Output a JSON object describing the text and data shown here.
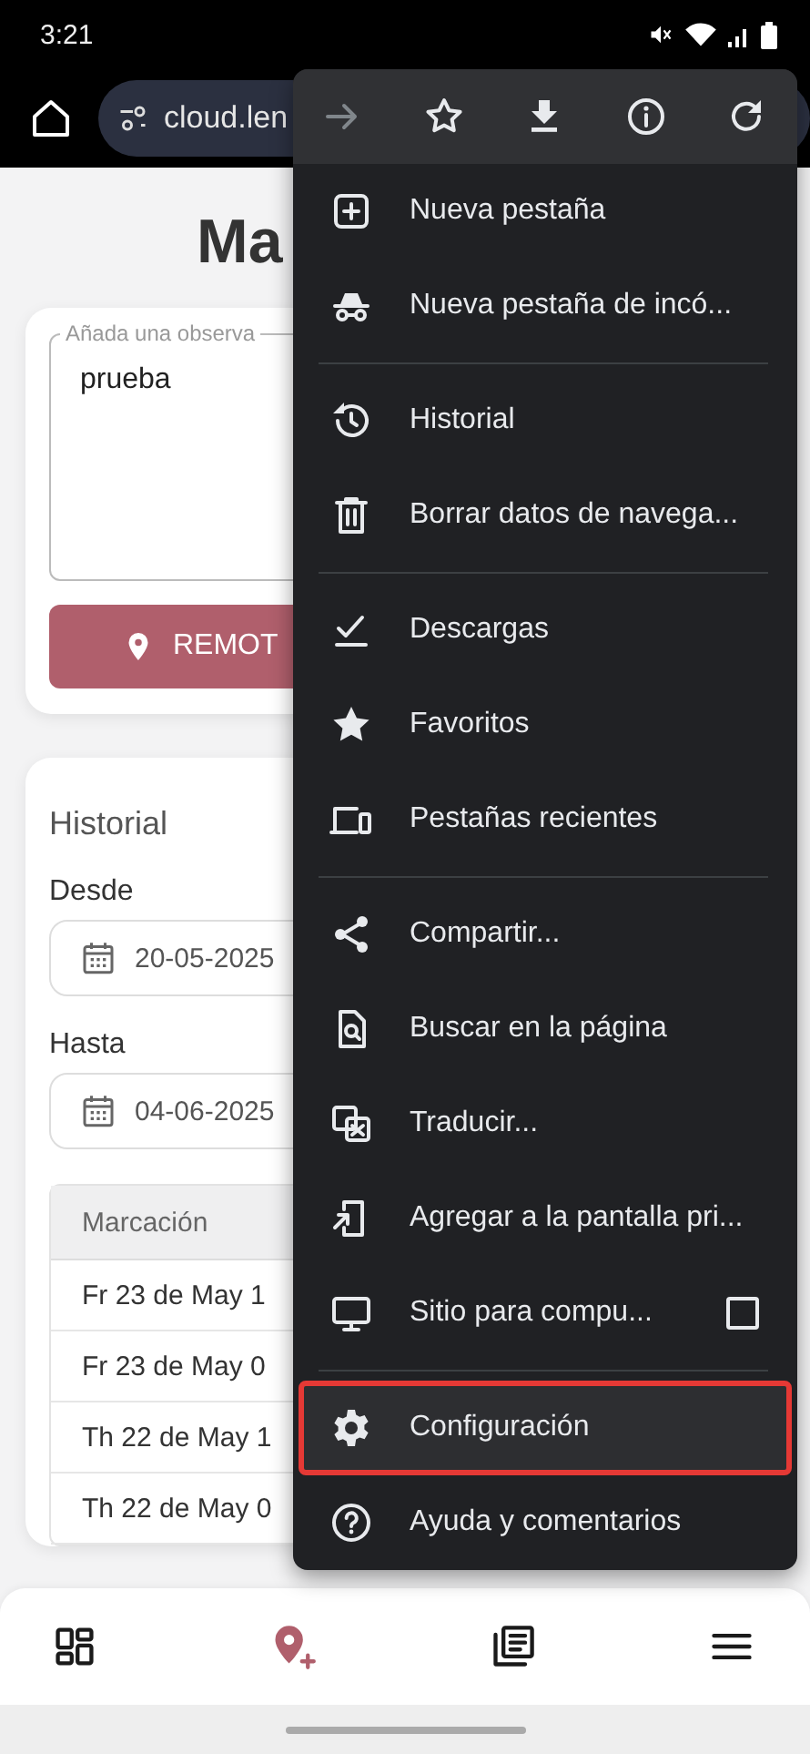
{
  "status_bar": {
    "time": "3:21"
  },
  "toolbar": {
    "url": "cloud.len"
  },
  "page": {
    "title": "Ma",
    "observation": {
      "placeholder": "Añada una observa",
      "value": "prueba"
    },
    "mark_button": "REMOT",
    "history": {
      "title": "Historial",
      "from_label": "Desde",
      "from_value": "20-05-2025",
      "to_label": "Hasta",
      "to_value": "04-06-2025",
      "table": {
        "columns": [
          "Marcación"
        ],
        "rows": [
          "Fr 23 de May 1",
          "Fr 23 de May 0",
          "Th 22 de May 1",
          "Th 22 de May 0"
        ]
      }
    }
  },
  "menu": {
    "actions": [
      {
        "kind": "forward",
        "disabled": true
      },
      {
        "kind": "star",
        "disabled": false
      },
      {
        "kind": "download",
        "disabled": false
      },
      {
        "kind": "info",
        "disabled": false
      },
      {
        "kind": "refresh",
        "disabled": false
      }
    ],
    "groups": [
      [
        {
          "kind": "new-tab",
          "label": "Nueva pestaña",
          "highlighted": false
        },
        {
          "kind": "incognito",
          "label": "Nueva pestaña de incó...",
          "highlighted": false
        }
      ],
      [
        {
          "kind": "history",
          "label": "Historial",
          "highlighted": false
        },
        {
          "kind": "trash",
          "label": "Borrar datos de navega...",
          "highlighted": false
        }
      ],
      [
        {
          "kind": "downloads",
          "label": "Descargas",
          "highlighted": false
        },
        {
          "kind": "bookmarks",
          "label": "Favoritos",
          "highlighted": false
        },
        {
          "kind": "devices",
          "label": "Pestañas recientes",
          "highlighted": false
        }
      ],
      [
        {
          "kind": "share",
          "label": "Compartir...",
          "highlighted": false
        },
        {
          "kind": "find",
          "label": "Buscar en la página",
          "highlighted": false
        },
        {
          "kind": "translate",
          "label": "Traducir...",
          "highlighted": false
        },
        {
          "kind": "add-home",
          "label": "Agregar a la pantalla pri...",
          "highlighted": false
        },
        {
          "kind": "desktop",
          "label": "Sitio para compu...",
          "highlighted": false,
          "checked": false
        }
      ],
      [
        {
          "kind": "settings",
          "label": "Configuración",
          "highlighted": true
        },
        {
          "kind": "help",
          "label": "Ayuda y comentarios",
          "highlighted": false
        }
      ]
    ]
  },
  "bottom_nav": [
    {
      "kind": "dashboard",
      "selected": false
    },
    {
      "kind": "add-location",
      "selected": true
    },
    {
      "kind": "records",
      "selected": false
    },
    {
      "kind": "menu",
      "selected": false
    }
  ]
}
